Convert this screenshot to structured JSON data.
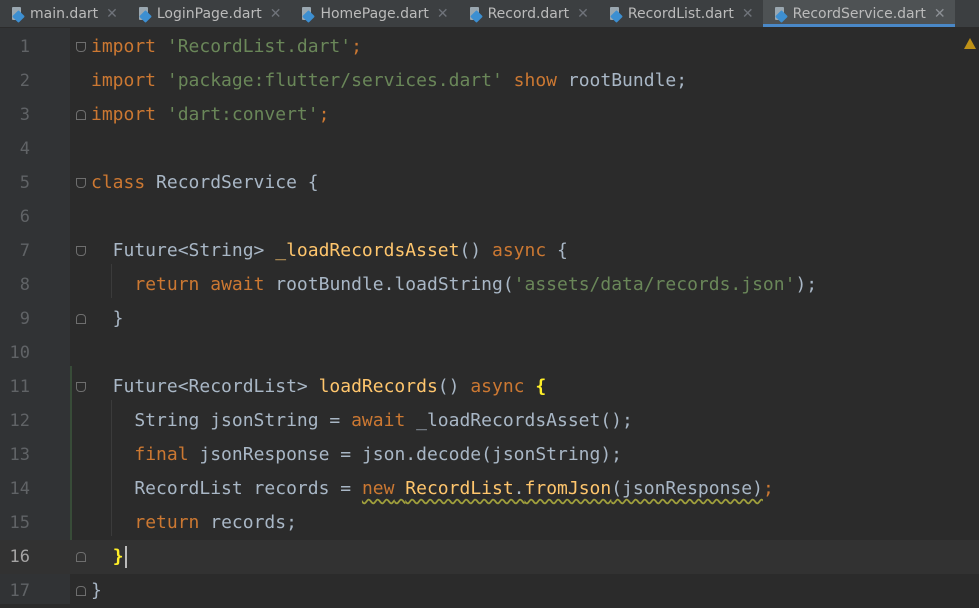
{
  "tabs": [
    {
      "label": "main.dart",
      "active": false
    },
    {
      "label": "LoginPage.dart",
      "active": false
    },
    {
      "label": "HomePage.dart",
      "active": false
    },
    {
      "label": "Record.dart",
      "active": false
    },
    {
      "label": "RecordList.dart",
      "active": false
    },
    {
      "label": "RecordService.dart",
      "active": true
    }
  ],
  "close_glyph": "✕",
  "line_numbers": [
    "1",
    "2",
    "3",
    "4",
    "5",
    "6",
    "7",
    "8",
    "9",
    "10",
    "11",
    "12",
    "13",
    "14",
    "15",
    "16",
    "17"
  ],
  "current_line": "16",
  "code": {
    "l1": [
      "import",
      " ",
      "'RecordList.dart'",
      ";"
    ],
    "l2": [
      "import",
      " ",
      "'package:flutter/services.dart'",
      " ",
      "show",
      " rootBundle;"
    ],
    "l3": [
      "import",
      " ",
      "'dart:convert'",
      ";"
    ],
    "l5": [
      "class",
      " RecordService {"
    ],
    "l7": [
      "  Future<String> ",
      "_loadRecordsAsset",
      "() ",
      "async",
      " {"
    ],
    "l8": [
      "    ",
      "return",
      " ",
      "await",
      " rootBundle.loadString(",
      "'assets/data/records.json'",
      ");"
    ],
    "l9": [
      "  }"
    ],
    "l11": [
      "  Future<RecordList> ",
      "loadRecords",
      "() ",
      "async",
      " ",
      "{"
    ],
    "l12": [
      "    String jsonString = ",
      "await",
      " _loadRecordsAsset();"
    ],
    "l13": [
      "    ",
      "final",
      " jsonResponse = json.decode(jsonString);"
    ],
    "l14": [
      "    RecordList records = ",
      "new",
      " ",
      "RecordList",
      ".",
      "fromJson",
      "(jsonResponse)",
      ";"
    ],
    "l15": [
      "    ",
      "return",
      " records;"
    ],
    "l16": [
      "  ",
      "}"
    ],
    "l17": [
      "}"
    ]
  },
  "colors": {
    "background": "#2b2b2b",
    "keyword": "#cc7832",
    "string": "#6a8759",
    "function": "#ffc66d",
    "text": "#a9b7c6",
    "tab_accent": "#4a88c7"
  },
  "icons": {
    "file": "dart-file-icon",
    "warning": "warning-icon"
  }
}
